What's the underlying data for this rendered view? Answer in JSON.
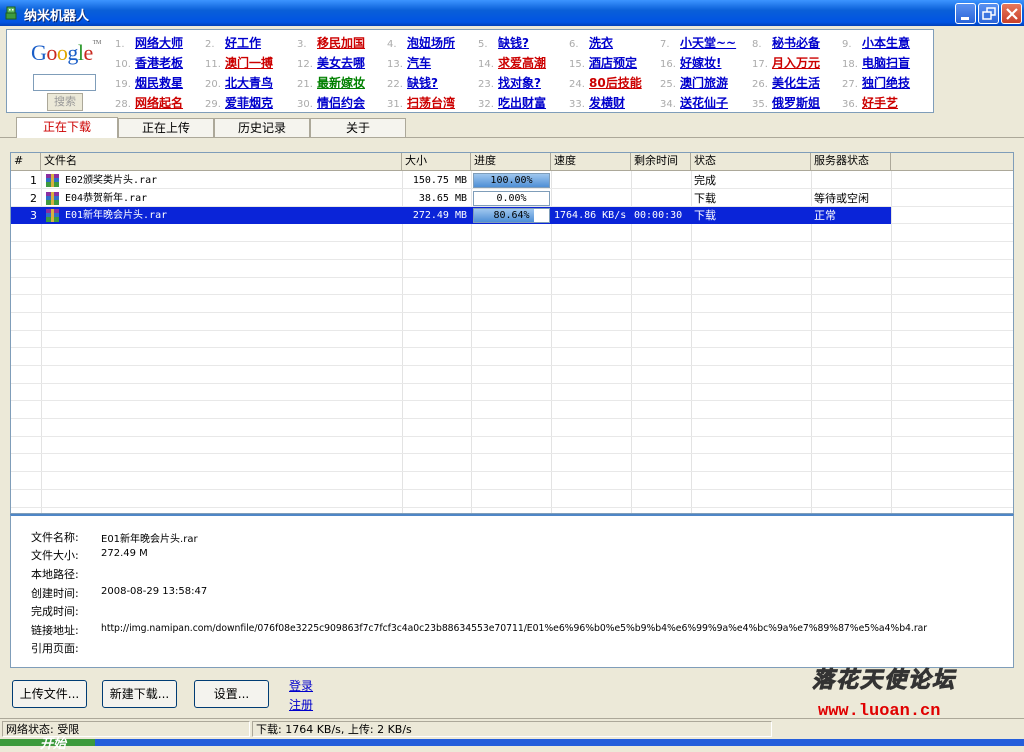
{
  "window": {
    "title": "纳米机器人"
  },
  "google": {
    "logo": "Google",
    "button_label": "搜索",
    "search_value": ""
  },
  "ad_links": [
    {
      "num": "1.",
      "label": "网络大师",
      "color": "#0000CC"
    },
    {
      "num": "2.",
      "label": "好工作",
      "color": "#0000CC"
    },
    {
      "num": "3.",
      "label": "移民加国",
      "color": "#CC0000"
    },
    {
      "num": "4.",
      "label": "泡妞场所",
      "color": "#0000CC"
    },
    {
      "num": "5.",
      "label": "缺钱?",
      "color": "#0000CC"
    },
    {
      "num": "6.",
      "label": "洗衣",
      "color": "#0000CC"
    },
    {
      "num": "7.",
      "label": "小天堂~~",
      "color": "#0000CC"
    },
    {
      "num": "8.",
      "label": "秘书必备",
      "color": "#0000CC"
    },
    {
      "num": "9.",
      "label": "小本生意",
      "color": "#0000CC"
    },
    {
      "num": "10.",
      "label": "香港老板",
      "color": "#0000CC"
    },
    {
      "num": "11.",
      "label": "澳门一搏",
      "color": "#CC0000"
    },
    {
      "num": "12.",
      "label": "美女去哪",
      "color": "#0000CC"
    },
    {
      "num": "13.",
      "label": "汽车",
      "color": "#0000CC"
    },
    {
      "num": "14.",
      "label": "求爱高潮",
      "color": "#CC0000"
    },
    {
      "num": "15.",
      "label": "酒店预定",
      "color": "#0000CC"
    },
    {
      "num": "16.",
      "label": "好嫁妆!",
      "color": "#0000CC"
    },
    {
      "num": "17.",
      "label": "月入万元",
      "color": "#CC0000"
    },
    {
      "num": "18.",
      "label": "电脑扫盲",
      "color": "#0000CC"
    },
    {
      "num": "19.",
      "label": "烟民救星",
      "color": "#0000CC"
    },
    {
      "num": "20.",
      "label": "北大青鸟",
      "color": "#0000CC"
    },
    {
      "num": "21.",
      "label": "最新嫁妆",
      "color": "#008000"
    },
    {
      "num": "22.",
      "label": "缺钱?",
      "color": "#0000CC"
    },
    {
      "num": "23.",
      "label": "找对象?",
      "color": "#0000CC"
    },
    {
      "num": "24.",
      "label": "80后技能",
      "color": "#CC0000"
    },
    {
      "num": "25.",
      "label": "澳门旅游",
      "color": "#0000CC"
    },
    {
      "num": "26.",
      "label": "美化生活",
      "color": "#0000CC"
    },
    {
      "num": "27.",
      "label": "独门绝技",
      "color": "#0000CC"
    },
    {
      "num": "28.",
      "label": "网络起名",
      "color": "#CC0000"
    },
    {
      "num": "29.",
      "label": "爱菲烟克",
      "color": "#0000CC"
    },
    {
      "num": "30.",
      "label": "情侣约会",
      "color": "#0000CC"
    },
    {
      "num": "31.",
      "label": "扫荡台湾",
      "color": "#CC0000"
    },
    {
      "num": "32.",
      "label": "吃出财富",
      "color": "#0000CC"
    },
    {
      "num": "33.",
      "label": "发横财",
      "color": "#0000CC"
    },
    {
      "num": "34.",
      "label": "送花仙子",
      "color": "#0000CC"
    },
    {
      "num": "35.",
      "label": "俄罗斯姐",
      "color": "#0000CC"
    },
    {
      "num": "36.",
      "label": "好手艺",
      "color": "#CC0000"
    }
  ],
  "tabs": [
    "正在下载",
    "正在上传",
    "历史记录",
    "关于"
  ],
  "columns": [
    "#",
    "文件名",
    "大小",
    "进度",
    "速度",
    "剩余时间",
    "状态",
    "服务器状态"
  ],
  "downloads": [
    {
      "index": "1",
      "name": "E02颁奖类片头.rar",
      "size": "150.75 MB",
      "progress_text": "100.00%",
      "progress": 1.0,
      "speed": "",
      "remaining": "",
      "status": "完成",
      "server_status": ""
    },
    {
      "index": "2",
      "name": "E04恭贺新年.rar",
      "size": "38.65 MB",
      "progress_text": "0.00%",
      "progress": 0.0,
      "speed": "",
      "remaining": "",
      "status": "下载",
      "server_status": "等待或空闲"
    },
    {
      "index": "3",
      "name": "E01新年晚会片头.rar",
      "size": "272.49 MB",
      "progress_text": "80.64%",
      "progress": 0.8064,
      "speed": "1764.86 KB/s",
      "remaining": "00:00:30",
      "status": "下载",
      "server_status": "正常"
    }
  ],
  "details": {
    "labels": {
      "name": "文件名称:",
      "size": "文件大小:",
      "path": "本地路径:",
      "created": "创建时间:",
      "completed": "完成时间:",
      "link": "链接地址:",
      "referer": "引用页面:"
    },
    "name": "E01新年晚会片头.rar",
    "size": "272.49 M",
    "path": "",
    "created": "2008-08-29 13:58:47",
    "completed": "",
    "link": "http://img.namipan.com/downfile/076f08e3225c909863f7c7fcf3c4a0c23b88634553e70711/E01%e6%96%b0%e5%b9%b4%e6%99%9a%e4%bc%9a%e7%89%87%e5%a4%b4.rar",
    "referer": ""
  },
  "buttons": {
    "upload": "上传文件...",
    "new_download": "新建下载...",
    "settings": "设置..."
  },
  "links": {
    "login": "登录",
    "register": "注册"
  },
  "status": {
    "network": "网络状态: 受限",
    "transfer": "下载: 1764 KB/s, 上传: 2 KB/s"
  },
  "taskbar": {
    "start": "开始"
  },
  "watermark": {
    "title": "落花天使论坛",
    "url": "www.luoan.cn"
  }
}
